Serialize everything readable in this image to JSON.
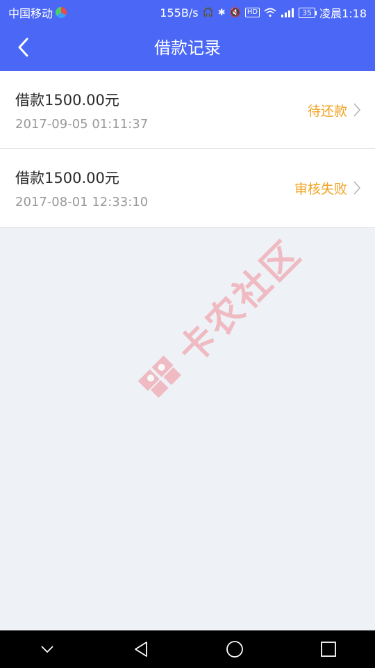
{
  "status_bar": {
    "carrier": "中国移动",
    "net_speed": "155B/s",
    "battery": "35",
    "time": "凌晨1:18"
  },
  "header": {
    "title": "借款记录",
    "back_icon": "chevron-left-icon"
  },
  "records": [
    {
      "amount": "借款1500.00元",
      "datetime": "2017-09-05 01:11:37",
      "status": "待还款"
    },
    {
      "amount": "借款1500.00元",
      "datetime": "2017-08-01 12:33:10",
      "status": "审核失败"
    }
  ],
  "watermark": {
    "text": "卡农社区"
  },
  "colors": {
    "brand": "#4a67f5",
    "status_orange": "#f0a321",
    "background": "#eef1f5",
    "watermark": "#f08e98"
  },
  "nav_icons": [
    "chevron-down-icon",
    "back-triangle-icon",
    "home-circle-icon",
    "recents-square-icon"
  ]
}
